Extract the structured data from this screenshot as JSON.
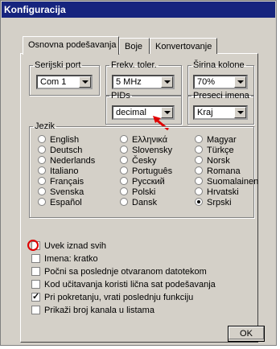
{
  "window": {
    "title": "Konfiguracija"
  },
  "tabs": [
    "Osnovna podešavanja",
    "Boje",
    "Konvertovanje"
  ],
  "groups": {
    "serial_port": {
      "label": "Serijski port",
      "value": "Com 1"
    },
    "freq_tol": {
      "label": "Frekv. toler.",
      "value": "5 MHz"
    },
    "col_width": {
      "label": "Širina kolone",
      "value": "70%"
    },
    "pids": {
      "label": "PIDs",
      "value": "decimal"
    },
    "name_cut": {
      "label": "Preseci imena",
      "value": "Kraj"
    }
  },
  "language": {
    "label": "Jezik",
    "col1": [
      "English",
      "Deutsch",
      "Nederlands",
      "Italiano",
      "Français",
      "Svenska",
      "Español"
    ],
    "col2": [
      "Ελληνικά",
      "Slovensky",
      "Česky",
      "Português",
      "Русский",
      "Polski",
      "Dansk"
    ],
    "col3": [
      "Magyar",
      "Türkçe",
      "Norsk",
      "Romana",
      "Suomalainen",
      "Hrvatski",
      "Srpski"
    ],
    "selected": "Srpski"
  },
  "options": [
    {
      "label": "Uvek iznad svih",
      "checked": false
    },
    {
      "label": "Imena: kratko",
      "checked": false
    },
    {
      "label": "Počni sa poslednje otvaranom datotekom",
      "checked": false
    },
    {
      "label": "Kod učitavanja koristi lična sat podešavanja",
      "checked": false
    },
    {
      "label": "Pri pokretanju, vrati poslednju funkciju",
      "checked": true
    },
    {
      "label": "Prikaži broj kanala u listama",
      "checked": false
    }
  ],
  "ok_label": "OK",
  "colors": {
    "titlebar": "#16247e",
    "annotation": "#e00000"
  }
}
